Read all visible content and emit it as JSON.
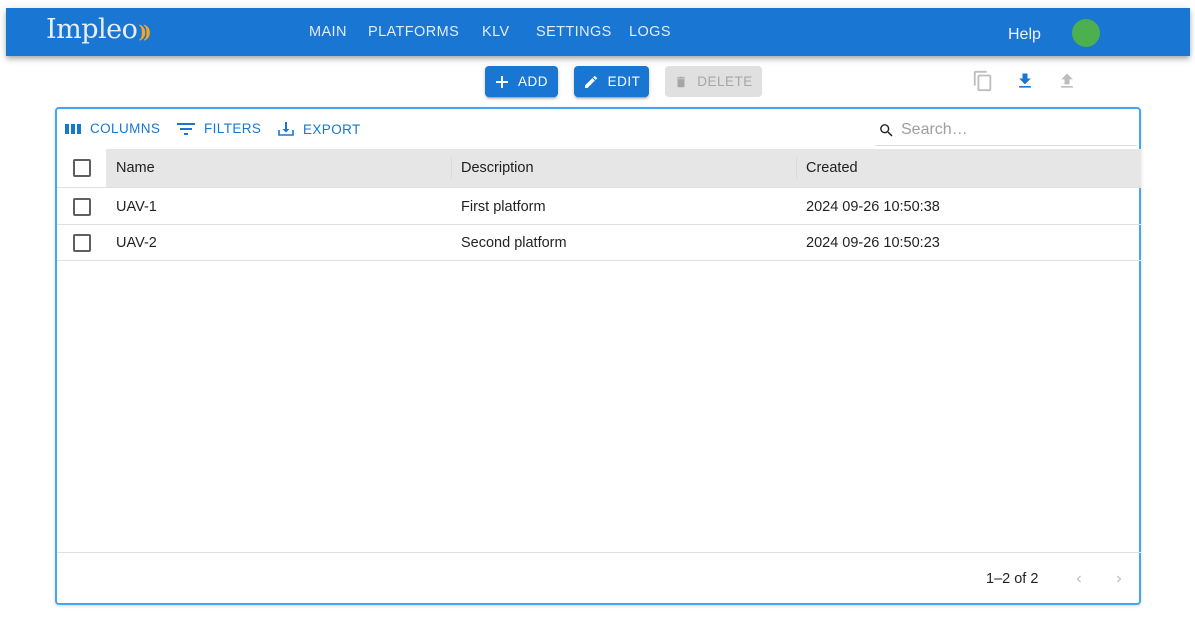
{
  "appbar": {
    "logo_text": "Impleo",
    "logo_mark": "))",
    "nav": [
      "MAIN",
      "PLATFORMS",
      "KLV",
      "SETTINGS",
      "LOGS"
    ],
    "help_label": "Help",
    "status_color": "#4caf50",
    "brand_color": "#1976d2"
  },
  "actions": {
    "add_label": "ADD",
    "edit_label": "EDIT",
    "delete_label": "DELETE",
    "icons": [
      "copy-icon",
      "download-icon",
      "upload-icon"
    ]
  },
  "grid": {
    "toolbar": {
      "columns_label": "COLUMNS",
      "filters_label": "FILTERS",
      "export_label": "EXPORT"
    },
    "search": {
      "placeholder": "Search…",
      "value": ""
    },
    "columns": [
      "Name",
      "Description",
      "Created"
    ],
    "rows": [
      {
        "name": "UAV-1",
        "description": "First platform",
        "created": "2024 09-26 10:50:38"
      },
      {
        "name": "UAV-2",
        "description": "Second platform",
        "created": "2024 09-26 10:50:23"
      }
    ],
    "pagination": {
      "label": "1–2 of 2"
    }
  }
}
